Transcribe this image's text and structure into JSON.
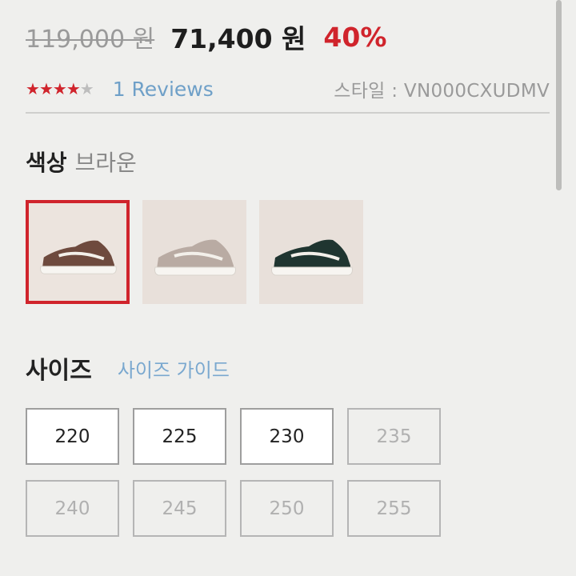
{
  "price": {
    "original": "119,000 원",
    "sale": "71,400 원",
    "discount": "40%"
  },
  "rating": {
    "stars_filled": 4,
    "stars_total": 5,
    "reviews_label": "1 Reviews",
    "style_code": "스타일 : VN000CXUDMV"
  },
  "color": {
    "label": "색상",
    "selected": "브라운",
    "swatches": [
      {
        "name": "brown",
        "upper": "#6e4a3e",
        "selected": true
      },
      {
        "name": "beige",
        "upper": "#b9aba3",
        "selected": false
      },
      {
        "name": "dark green",
        "upper": "#1f3530",
        "selected": false
      }
    ]
  },
  "size": {
    "label": "사이즈",
    "guide_label": "사이즈 가이드",
    "options": [
      {
        "value": "220",
        "available": true
      },
      {
        "value": "225",
        "available": true
      },
      {
        "value": "230",
        "available": true
      },
      {
        "value": "235",
        "available": false
      },
      {
        "value": "240",
        "available": false
      },
      {
        "value": "245",
        "available": false
      },
      {
        "value": "250",
        "available": false
      },
      {
        "value": "255",
        "available": false
      }
    ]
  },
  "colors": {
    "accent": "#d0242c",
    "link": "#6fa0c8",
    "star_filled": "#d0242c",
    "star_empty": "#bdbdbd"
  }
}
